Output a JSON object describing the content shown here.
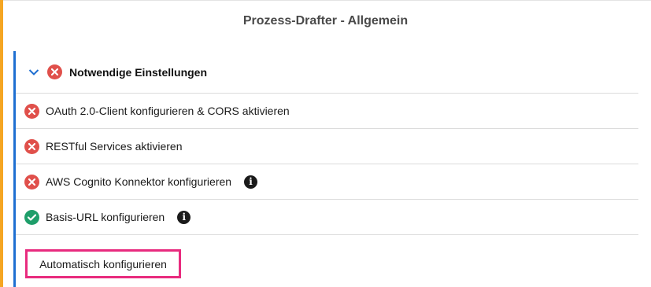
{
  "page": {
    "title": "Prozess-Drafter - Allgemein"
  },
  "section": {
    "label": "Notwendige Einstellungen",
    "status": "error",
    "expanded": true,
    "items": [
      {
        "label": "OAuth 2.0-Client konfigurieren & CORS aktivieren",
        "status": "error",
        "info": false
      },
      {
        "label": "RESTful Services aktivieren",
        "status": "error",
        "info": false
      },
      {
        "label": "AWS Cognito Konnektor konfigurieren",
        "status": "error",
        "info": true
      },
      {
        "label": "Basis-URL konfigurieren",
        "status": "ok",
        "info": true
      }
    ]
  },
  "actions": {
    "auto_configure": "Automatisch konfigurieren"
  },
  "colors": {
    "error": "#e0504b",
    "ok": "#1e9e6a",
    "accent_blue": "#1f6fd1",
    "rail_orange": "#f5a623",
    "highlight": "#e82b7e"
  }
}
